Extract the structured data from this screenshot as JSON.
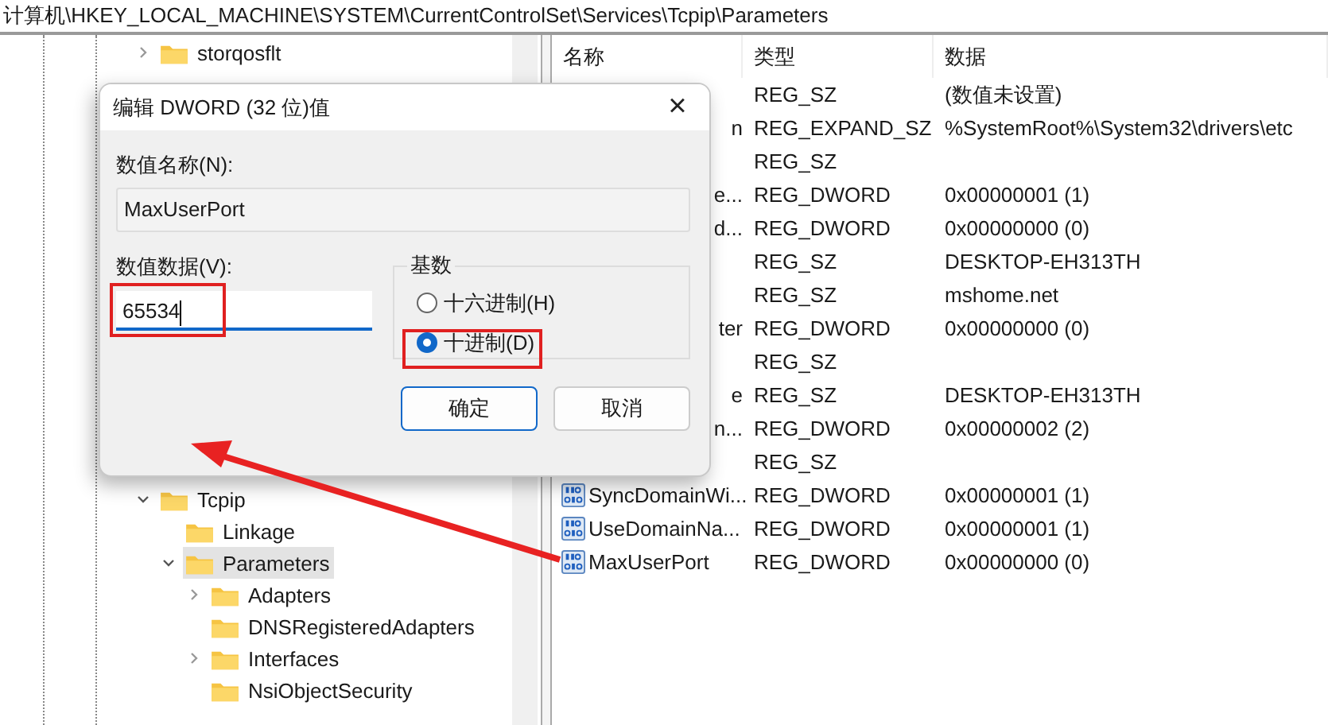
{
  "address_bar": {
    "path": "计算机\\HKEY_LOCAL_MACHINE\\SYSTEM\\CurrentControlSet\\Services\\Tcpip\\Parameters"
  },
  "tree": [
    {
      "label": "storqosflt",
      "expandable": true,
      "expanded": false,
      "selected": false
    },
    {
      "label": "Tcpip",
      "expandable": true,
      "expanded": true,
      "selected": false,
      "children": [
        {
          "label": "Linkage",
          "expandable": false,
          "selected": false
        },
        {
          "label": "Parameters",
          "expandable": true,
          "expanded": true,
          "selected": true,
          "children": [
            {
              "label": "Adapters",
              "expandable": true,
              "expanded": false,
              "selected": false
            },
            {
              "label": "DNSRegisteredAdapters",
              "expandable": false,
              "selected": false
            },
            {
              "label": "Interfaces",
              "expandable": true,
              "expanded": false,
              "selected": false
            },
            {
              "label": "NsiObjectSecurity",
              "expandable": false,
              "selected": false
            }
          ]
        }
      ]
    }
  ],
  "list": {
    "columns": [
      "名称",
      "类型",
      "数据"
    ],
    "rows": [
      {
        "name": "",
        "icon_visible": false,
        "type": "REG_SZ",
        "data": "(数值未设置)"
      },
      {
        "name": "n",
        "icon_visible": false,
        "type": "REG_EXPAND_SZ",
        "data": "%SystemRoot%\\System32\\drivers\\etc"
      },
      {
        "name": "",
        "icon_visible": false,
        "type": "REG_SZ",
        "data": ""
      },
      {
        "name": "e...",
        "icon_visible": false,
        "type": "REG_DWORD",
        "data": "0x00000001 (1)"
      },
      {
        "name": "d...",
        "icon_visible": false,
        "type": "REG_DWORD",
        "data": "0x00000000 (0)"
      },
      {
        "name": "",
        "icon_visible": false,
        "type": "REG_SZ",
        "data": "DESKTOP-EH313TH"
      },
      {
        "name": "",
        "icon_visible": false,
        "type": "REG_SZ",
        "data": "mshome.net"
      },
      {
        "name": "ter",
        "icon_visible": false,
        "type": "REG_DWORD",
        "data": "0x00000000 (0)"
      },
      {
        "name": "",
        "icon_visible": false,
        "type": "REG_SZ",
        "data": ""
      },
      {
        "name": "e",
        "icon_visible": false,
        "type": "REG_SZ",
        "data": "DESKTOP-EH313TH"
      },
      {
        "name": "n...",
        "icon_visible": false,
        "type": "REG_DWORD",
        "data": "0x00000002 (2)"
      },
      {
        "name": "",
        "icon_visible": false,
        "type": "REG_SZ",
        "data": ""
      },
      {
        "name": "SyncDomainWi...",
        "icon_visible": true,
        "type": "REG_DWORD",
        "data": "0x00000001 (1)"
      },
      {
        "name": "UseDomainNa...",
        "icon_visible": true,
        "type": "REG_DWORD",
        "data": "0x00000001 (1)"
      },
      {
        "name": "MaxUserPort",
        "icon_visible": true,
        "type": "REG_DWORD",
        "data": "0x00000000 (0)"
      }
    ]
  },
  "dialog": {
    "title": "编辑 DWORD (32 位)值",
    "close": "×",
    "name_label": "数值名称(N):",
    "name_value": "MaxUserPort",
    "data_label": "数值数据(V):",
    "data_value": "65534",
    "base_label": "基数",
    "radios": [
      {
        "label": "十六进制(H)",
        "selected": false
      },
      {
        "label": "十进制(D)",
        "selected": true
      }
    ],
    "buttons": [
      {
        "label": "确定",
        "default": true
      },
      {
        "label": "取消",
        "default": false
      }
    ]
  }
}
